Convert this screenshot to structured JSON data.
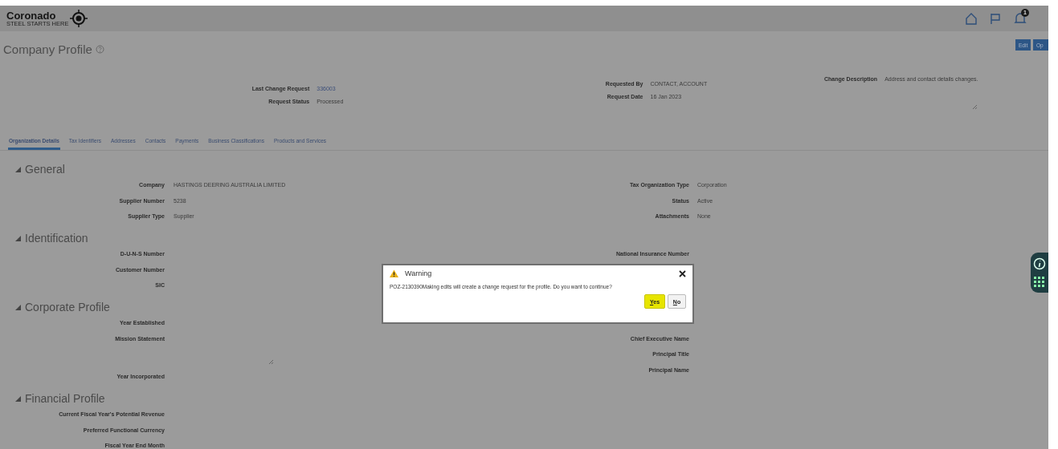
{
  "header": {
    "logo": "Coronado",
    "tagline": "STEEL STARTS HERE",
    "notification_count": "1"
  },
  "page": {
    "title": "Company Profile",
    "actions": [
      "Edit",
      "Op"
    ]
  },
  "request": {
    "groups": [
      [
        {
          "label": "Last Change Request",
          "value": "336003",
          "kind": "link"
        },
        {
          "label": "Request Status",
          "value": "Processed",
          "kind": "text"
        }
      ],
      [
        {
          "label": "Requested By",
          "value": "CONTACT, ACCOUNT",
          "kind": "text"
        },
        {
          "label": "Request Date",
          "value": "16 Jan 2023",
          "kind": "text"
        }
      ],
      [
        {
          "label": "Change Description",
          "value": "Address and contact details changes.",
          "kind": "textarea"
        }
      ]
    ]
  },
  "tabs": [
    {
      "label": "Organization Details",
      "selected": true
    },
    {
      "label": "Tax Identifiers",
      "selected": false
    },
    {
      "label": "Addresses",
      "selected": false
    },
    {
      "label": "Contacts",
      "selected": false
    },
    {
      "label": "Payments",
      "selected": false
    },
    {
      "label": "Business Classifications",
      "selected": false
    },
    {
      "label": "Products and Services",
      "selected": false
    }
  ],
  "sections": [
    {
      "title": "General",
      "expanded": true,
      "left": [
        {
          "label": "Company",
          "value": "HASTINGS DEERING AUSTRALIA LIMITED"
        },
        {
          "label": "Supplier Number",
          "value": "5238"
        },
        {
          "label": "Supplier Type",
          "value": "Supplier"
        }
      ],
      "right": [
        {
          "label": "Tax Organization Type",
          "value": "Corporation"
        },
        {
          "label": "Status",
          "value": "Active"
        },
        {
          "label": "Attachments",
          "value": "None"
        }
      ]
    },
    {
      "title": "Identification",
      "expanded": true,
      "left": [
        {
          "label": "D-U-N-S Number"
        },
        {
          "label": "Customer Number"
        },
        {
          "label": "SIC"
        }
      ],
      "right": [
        {
          "label": "National Insurance Number"
        }
      ]
    },
    {
      "title": "Corporate Profile",
      "expanded": true,
      "left": [
        {
          "label": "Year Established"
        },
        {
          "label": "Mission Statement",
          "kind": "textarea"
        },
        {
          "label": "Year Incorporated"
        }
      ],
      "right": [
        {
          "label": "Chief Executive Name"
        },
        {
          "label": "Principal Title"
        },
        {
          "label": "Principal Name"
        }
      ]
    },
    {
      "title": "Financial Profile",
      "expanded": true,
      "left": [
        {
          "label": "Current Fiscal Year's Potential Revenue"
        },
        {
          "label": "Preferred Functional Currency"
        },
        {
          "label": "Fiscal Year End Month"
        }
      ]
    }
  ],
  "dialog": {
    "title": "Warning",
    "message": "POZ-2130390Making edits will create a change request for the profile. Do you want to continue?",
    "buttons": [
      {
        "label": "Yes",
        "focused": true
      },
      {
        "label": "No",
        "focused": false
      }
    ]
  }
}
